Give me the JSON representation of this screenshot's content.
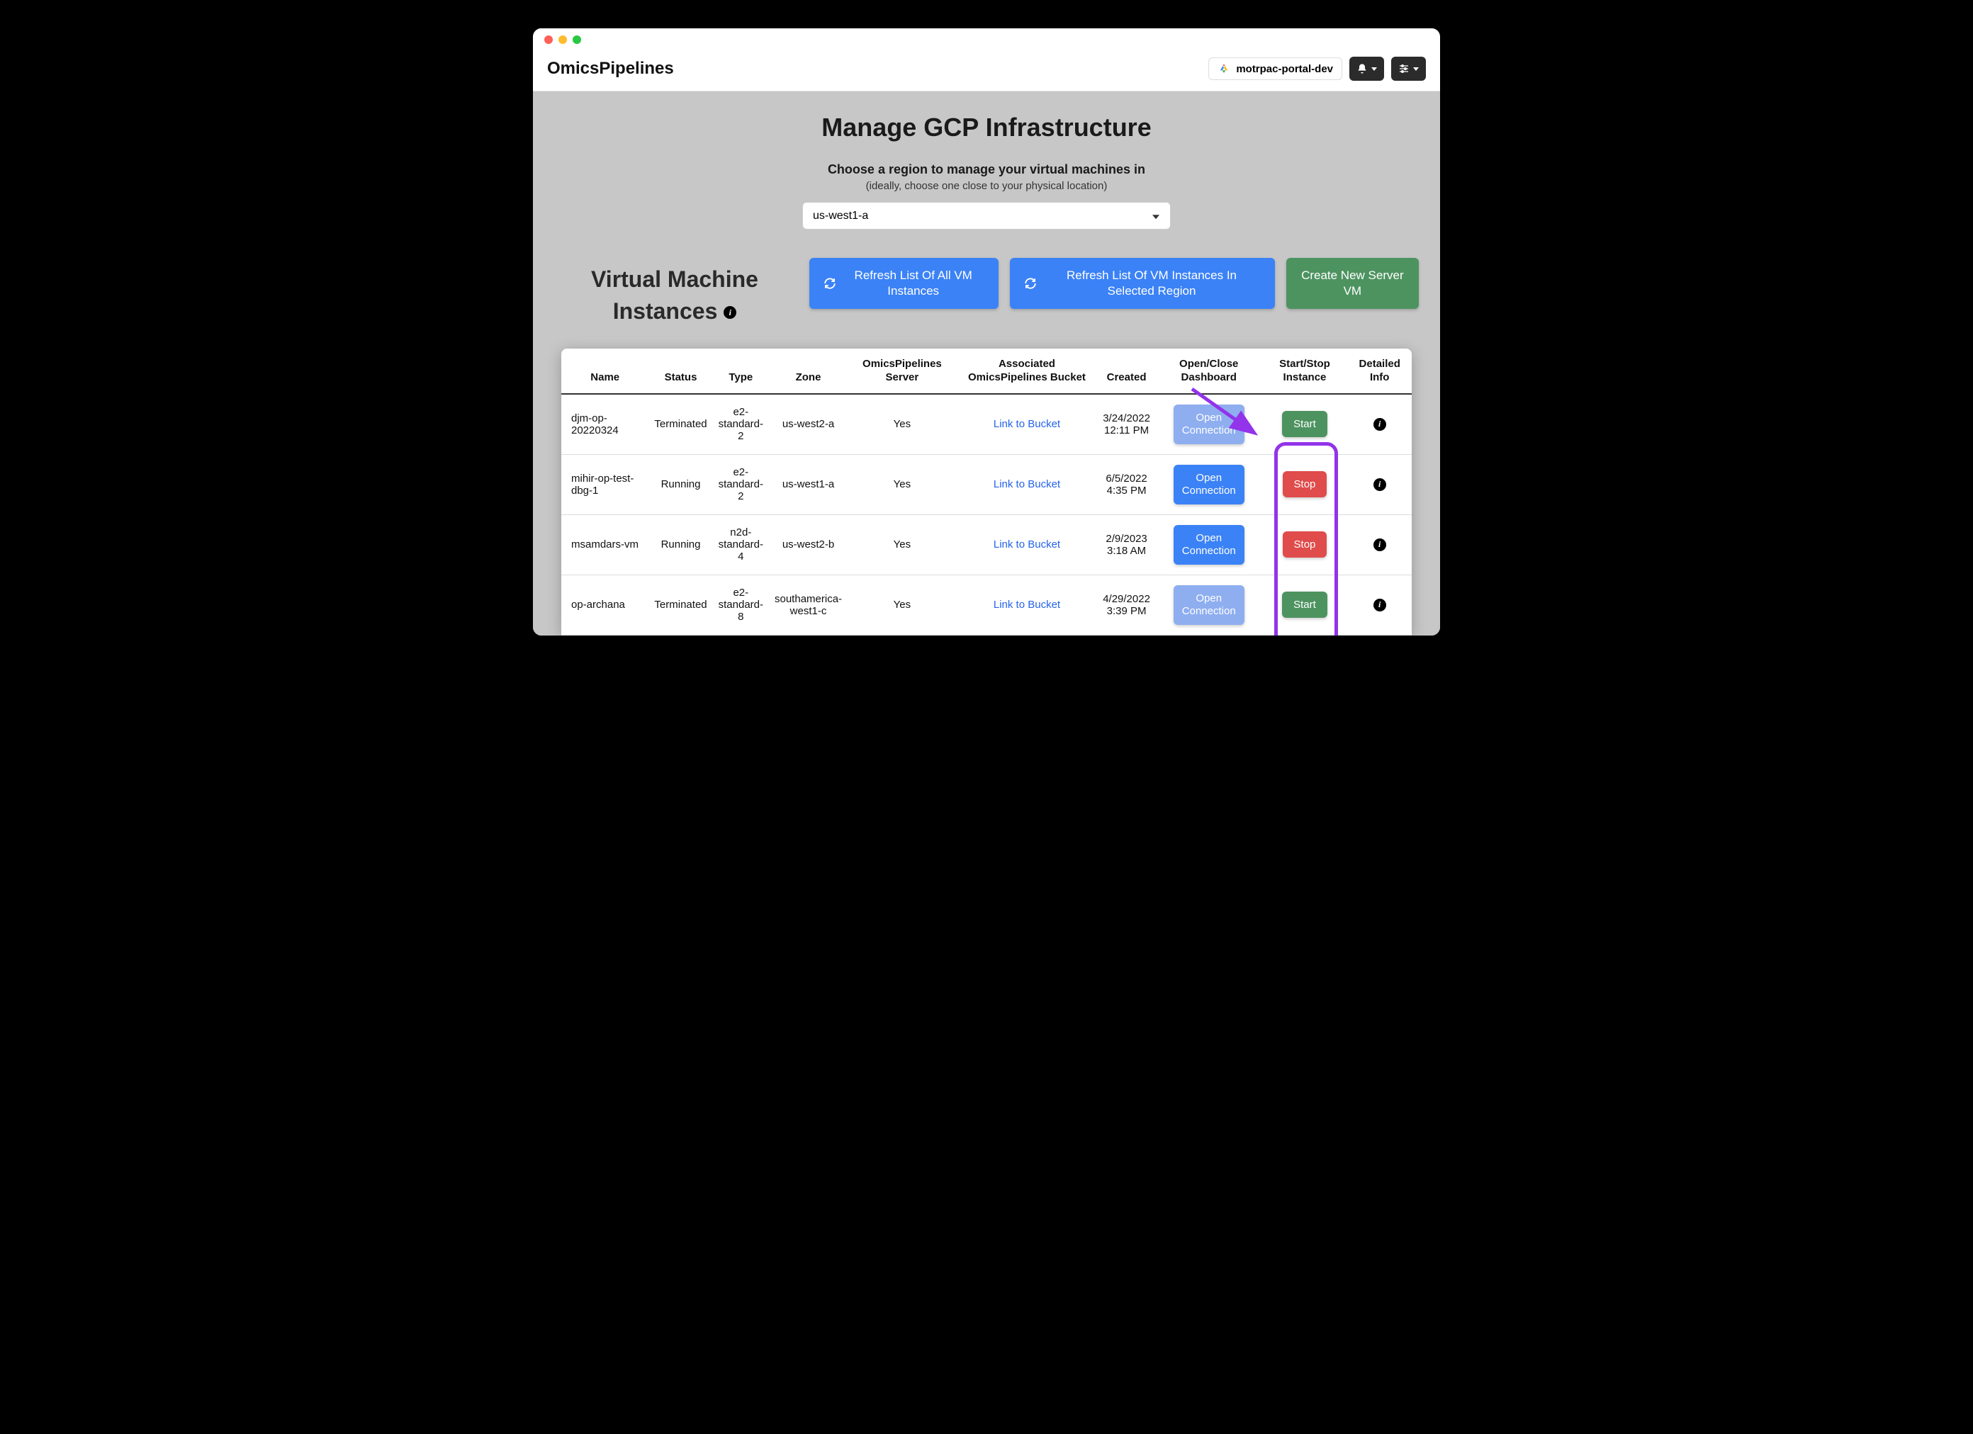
{
  "header": {
    "brand": "OmicsPipelines",
    "project": "motrpac-portal-dev"
  },
  "page": {
    "title": "Manage GCP Infrastructure",
    "region_label": "Choose a region to manage your virtual machines in",
    "region_sublabel": "(ideally, choose one close to your physical location)",
    "region_selected": "us-west1-a",
    "section_heading_l1": "Virtual Machine",
    "section_heading_l2": "Instances"
  },
  "buttons": {
    "refresh_all": "Refresh List Of All VM Instances",
    "refresh_region": "Refresh List Of VM Instances In Selected Region",
    "create_vm": "Create New Server VM",
    "open_connection": "Open Connection",
    "start": "Start",
    "stop": "Stop"
  },
  "table": {
    "headers": {
      "name": "Name",
      "status": "Status",
      "type": "Type",
      "zone": "Zone",
      "server": "OmicsPipelines Server",
      "bucket": "Associated OmicsPipelines Bucket",
      "created": "Created",
      "dashboard": "Open/Close Dashboard",
      "startstop": "Start/Stop Instance",
      "detail": "Detailed Info"
    },
    "link_text": "Link to Bucket",
    "rows": [
      {
        "name": "djm-op-20220324",
        "status": "Terminated",
        "type": "e2-standard-2",
        "zone": "us-west2-a",
        "server": "Yes",
        "created": "3/24/2022 12:11 PM",
        "conn_enabled": false,
        "action": "Start"
      },
      {
        "name": "mihir-op-test-dbg-1",
        "status": "Running",
        "type": "e2-standard-2",
        "zone": "us-west1-a",
        "server": "Yes",
        "created": "6/5/2022 4:35 PM",
        "conn_enabled": true,
        "action": "Stop"
      },
      {
        "name": "msamdars-vm",
        "status": "Running",
        "type": "n2d-standard-4",
        "zone": "us-west2-b",
        "server": "Yes",
        "created": "2/9/2023 3:18 AM",
        "conn_enabled": true,
        "action": "Stop"
      },
      {
        "name": "op-archana",
        "status": "Terminated",
        "type": "e2-standard-8",
        "zone": "southamerica-west1-c",
        "server": "Yes",
        "created": "4/29/2022 3:39 PM",
        "conn_enabled": false,
        "action": "Start"
      }
    ]
  }
}
